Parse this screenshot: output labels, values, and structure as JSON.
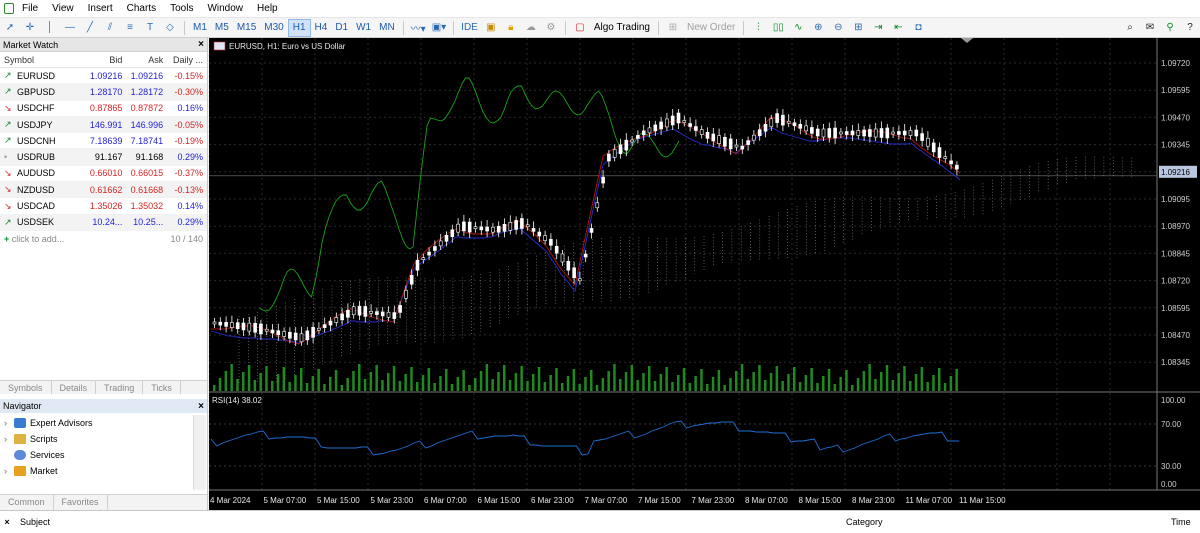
{
  "menu": [
    "File",
    "View",
    "Insert",
    "Charts",
    "Tools",
    "Window",
    "Help"
  ],
  "toolbar": {
    "timeframes": [
      "M1",
      "M5",
      "M15",
      "M30",
      "H1",
      "H4",
      "D1",
      "W1",
      "MN"
    ],
    "active_tf": "H1",
    "ide": "IDE",
    "algo": "Algo Trading",
    "new_order": "New Order"
  },
  "market_watch": {
    "title": "Market Watch",
    "close": "×",
    "headers": {
      "symbol": "Symbol",
      "bid": "Bid",
      "ask": "Ask",
      "daily": "Daily ..."
    },
    "rows": [
      {
        "symbol": "EURUSD",
        "dir": "up",
        "bid": "1.09216",
        "ask": "1.09216",
        "daily": "-0.15%",
        "color": "#2323d6"
      },
      {
        "symbol": "GBPUSD",
        "dir": "up",
        "bid": "1.28170",
        "ask": "1.28172",
        "daily": "-0.30%",
        "color": "#2323d6"
      },
      {
        "symbol": "USDCHF",
        "dir": "down",
        "bid": "0.87865",
        "ask": "0.87872",
        "daily": "0.16%",
        "color": "#d62323"
      },
      {
        "symbol": "USDJPY",
        "dir": "up",
        "bid": "146.991",
        "ask": "146.996",
        "daily": "-0.05%",
        "color": "#2323d6"
      },
      {
        "symbol": "USDCNH",
        "dir": "up",
        "bid": "7.18639",
        "ask": "7.18741",
        "daily": "-0.19%",
        "color": "#2323d6"
      },
      {
        "symbol": "USDRUB",
        "dir": "flat",
        "bid": "91.167",
        "ask": "91.168",
        "daily": "0.29%",
        "color": "#000000"
      },
      {
        "symbol": "AUDUSD",
        "dir": "down",
        "bid": "0.66010",
        "ask": "0.66015",
        "daily": "-0.37%",
        "color": "#d62323"
      },
      {
        "symbol": "NZDUSD",
        "dir": "down",
        "bid": "0.61662",
        "ask": "0.61668",
        "daily": "-0.13%",
        "color": "#d62323"
      },
      {
        "symbol": "USDCAD",
        "dir": "down",
        "bid": "1.35026",
        "ask": "1.35032",
        "daily": "0.14%",
        "color": "#d62323"
      },
      {
        "symbol": "USDSEK",
        "dir": "up",
        "bid": "10.24...",
        "ask": "10.25...",
        "daily": "0.29%",
        "color": "#2323d6"
      }
    ],
    "footer_add": "click to add...",
    "footer_count": "10 / 140",
    "tabs": [
      "Symbols",
      "Details",
      "Trading",
      "Ticks"
    ]
  },
  "navigator": {
    "title": "Navigator",
    "close": "×",
    "items": [
      "Expert Advisors",
      "Scripts",
      "Services",
      "Market"
    ],
    "tabs": [
      "Common",
      "Favorites"
    ]
  },
  "chart": {
    "title": "EURUSD, H1:  Euro vs US Dollar",
    "current_price": "1.09216",
    "price_ticks": [
      "1.09720",
      "1.09595",
      "1.09470",
      "1.09345",
      "1.09216",
      "1.09095",
      "1.08970",
      "1.08845",
      "1.08720",
      "1.08595",
      "1.08470",
      "1.08345"
    ],
    "time_ticks": [
      "4 Mar 2024",
      "5 Mar 07:00",
      "5 Mar 15:00",
      "5 Mar 23:00",
      "6 Mar 07:00",
      "6 Mar 15:00",
      "6 Mar 23:00",
      "7 Mar 07:00",
      "7 Mar 15:00",
      "7 Mar 23:00",
      "8 Mar 07:00",
      "8 Mar 15:00",
      "8 Mar 23:00",
      "11 Mar 07:00",
      "11 Mar 15:00"
    ],
    "rsi_label": "RSI(14) 38.02",
    "rsi_ticks": [
      "100.00",
      "70.00",
      "30.00",
      "0.00"
    ],
    "colors": {
      "bg": "#000000",
      "candle": "#ffffff",
      "volume": "#1f8a1f",
      "chikou": "#19a319",
      "kijun": "#2b2bd0",
      "tenkan": "#b01414",
      "rsi": "#1e6fd6",
      "cloud": "#d8d8d8"
    }
  },
  "toolbox": {
    "close": "×",
    "subject": "Subject",
    "category": "Category",
    "time": "Time"
  }
}
